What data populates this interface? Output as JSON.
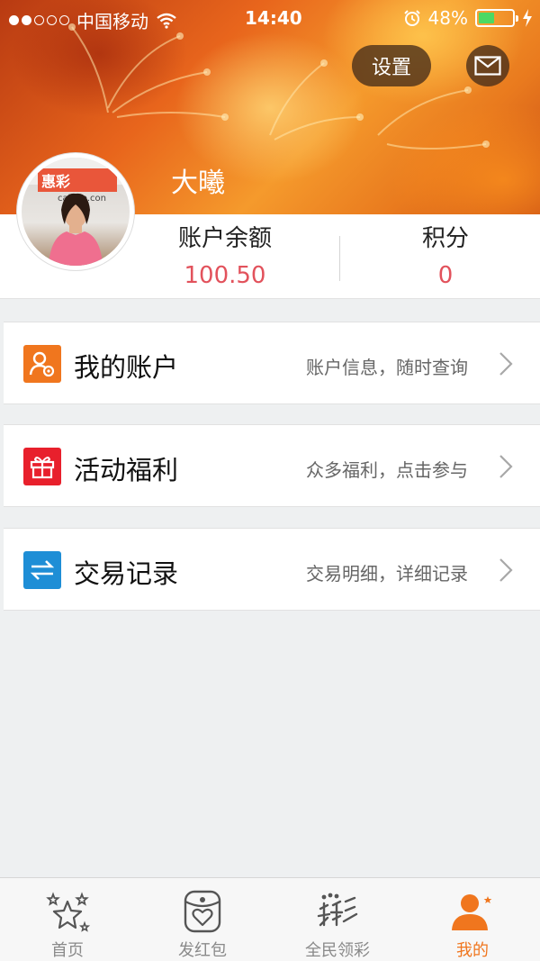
{
  "status_bar": {
    "carrier": "中国移动",
    "time": "14:40",
    "battery_percent": "48%",
    "battery_level": 0.48,
    "signal_bars_filled": 2,
    "signal_bars_total": 5
  },
  "header": {
    "settings_label": "设置",
    "message_icon": "mail-icon",
    "username": "大曦",
    "avatar_sign_text": "惠彩",
    "avatar_sign_url": "caibao.con"
  },
  "summary": {
    "balance_label": "账户余额",
    "balance_value": "100.50",
    "points_label": "积分",
    "points_value": "0"
  },
  "menu": [
    {
      "title": "我的账户",
      "desc": "账户信息，随时查询",
      "icon": "account-settings-icon",
      "color": "#f0761e"
    },
    {
      "title": "活动福利",
      "desc": "众多福利，点击参与",
      "icon": "gift-icon",
      "color": "#e8202c"
    },
    {
      "title": "交易记录",
      "desc": "交易明细，详细记录",
      "icon": "transfer-arrows-icon",
      "color": "#1e8ed6"
    }
  ],
  "tabbar": [
    {
      "label": "首页",
      "icon": "stars-icon",
      "active": false
    },
    {
      "label": "发红包",
      "icon": "red-packet-icon",
      "active": false
    },
    {
      "label": "全民领彩",
      "icon": "lottery-icon",
      "active": false
    },
    {
      "label": "我的",
      "icon": "user-icon",
      "active": true
    }
  ],
  "colors": {
    "accent": "#f0761e",
    "value_red": "#e2525c",
    "background": "#eef0f1"
  }
}
